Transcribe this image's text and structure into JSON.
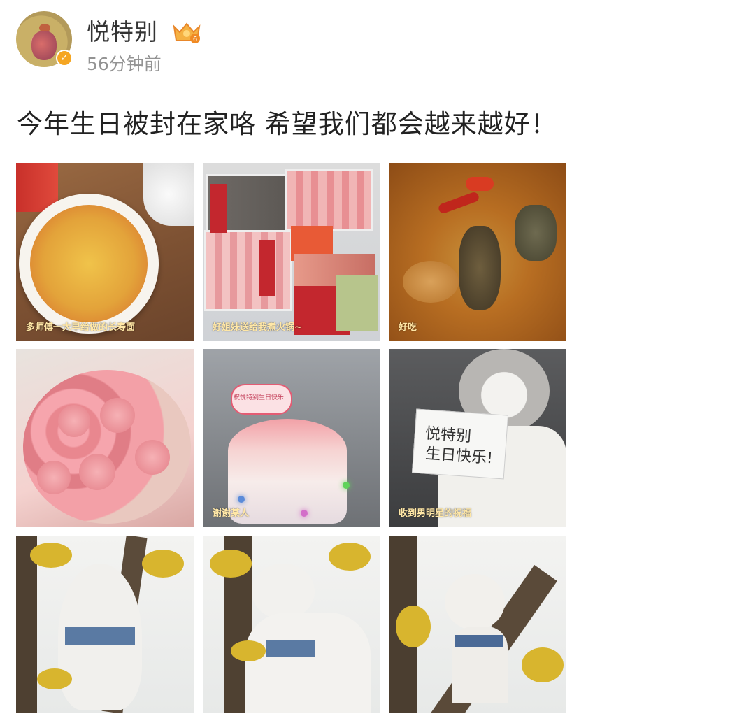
{
  "post": {
    "username": "悦特别",
    "timestamp": "56分钟前",
    "text": "今年生日被封在家咯 希望我们都会越来越好！",
    "verified_badge": "verified-badge",
    "crown_badge": "vip-crown-badge"
  },
  "photos": [
    {
      "caption": "多师傅一大早给做的长寿面"
    },
    {
      "caption": "好姐妹送给我煮火锅~"
    },
    {
      "caption": "好吃"
    },
    {
      "caption": ""
    },
    {
      "caption": "谢谢某人"
    },
    {
      "caption": "收到男明星的祝福"
    },
    {
      "caption": ""
    },
    {
      "caption": ""
    },
    {
      "caption": ""
    }
  ],
  "photo_texts": {
    "cake_topper": "祝悦特别生日快乐",
    "card_line1": "悦特别",
    "card_line2": "生日快乐!"
  },
  "colors": {
    "verified": "#f5a623",
    "timestamp": "#939393",
    "caption": "#ffe7a6"
  }
}
